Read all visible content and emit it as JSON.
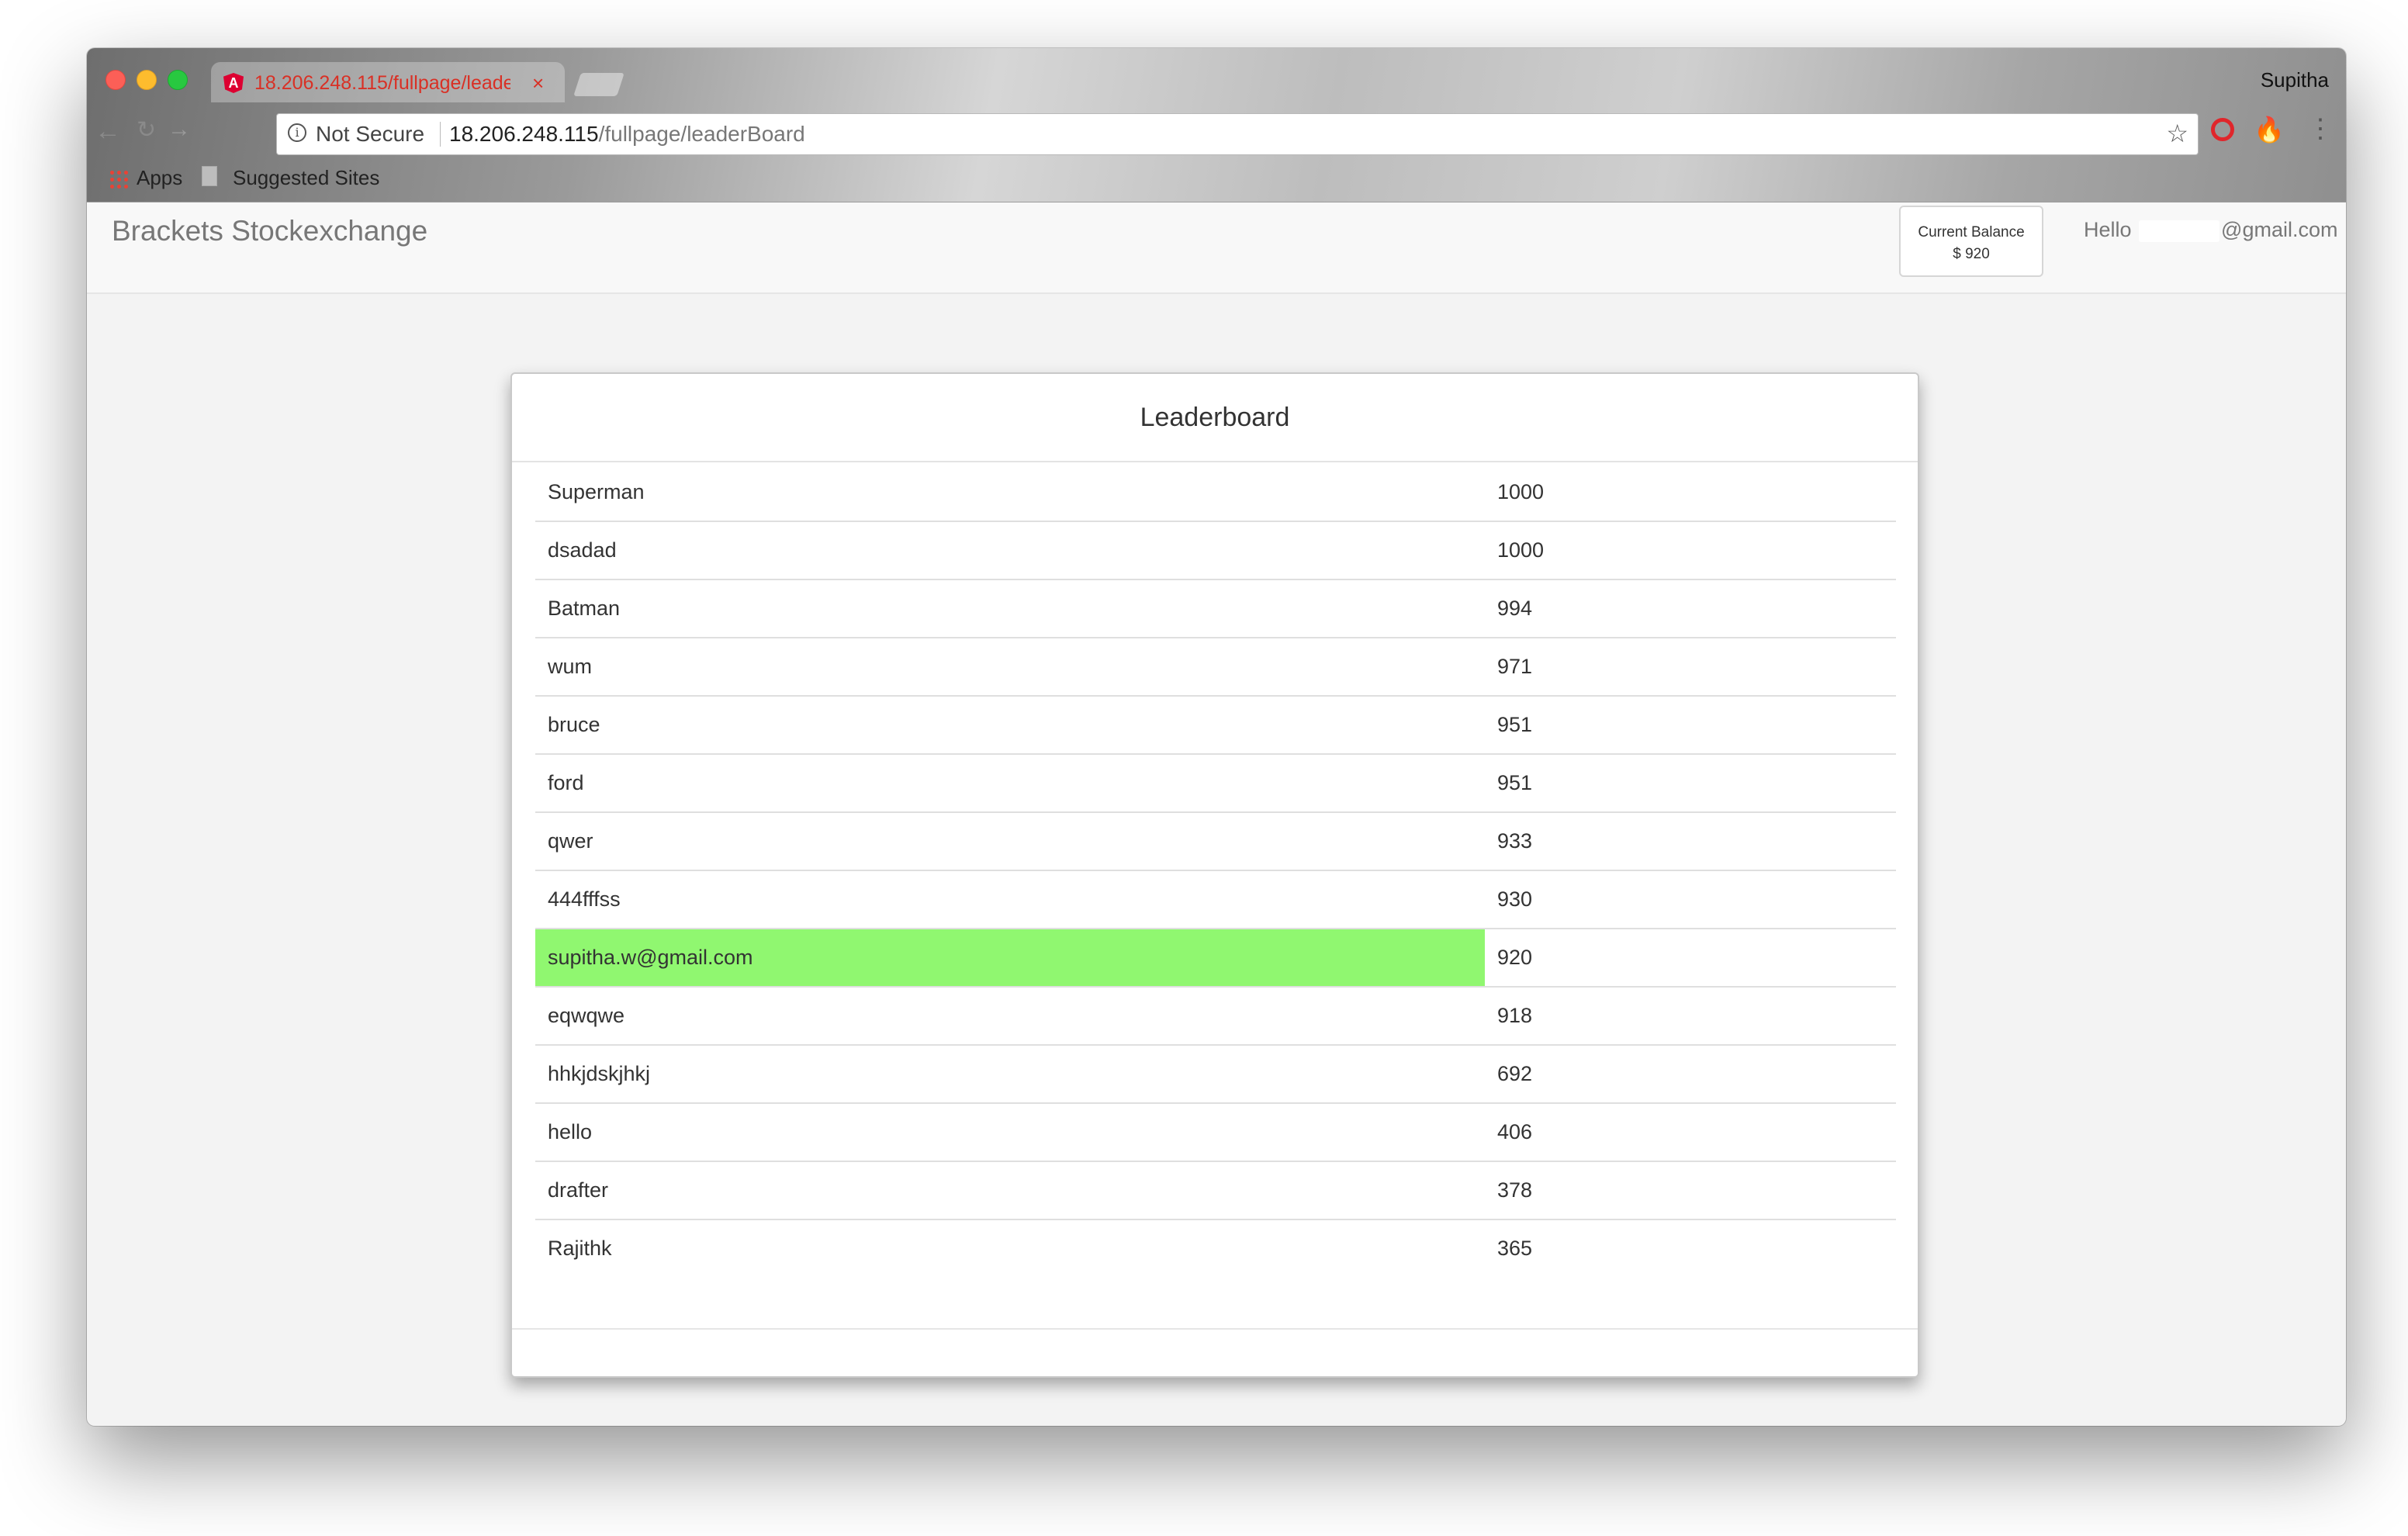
{
  "browser": {
    "tab_title": "18.206.248.115/fullpage/leade",
    "tab_close": "×",
    "profile_name": "Supitha",
    "security_label": "Not Secure",
    "url_host": "18.206.248.115",
    "url_path": "/fullpage/leaderBoard",
    "bookmarks": [
      "Apps",
      "Suggested Sites"
    ]
  },
  "navbar": {
    "brand": "Brackets Stockexchange",
    "balance_label": "Current Balance",
    "balance_value": "$ 920",
    "hello_prefix": "Hello",
    "hello_email_suffix": "@gmail.com"
  },
  "leaderboard": {
    "title": "Leaderboard",
    "rows": [
      {
        "name": "Superman",
        "score": "1000"
      },
      {
        "name": "dsadad",
        "score": "1000"
      },
      {
        "name": "Batman",
        "score": "994"
      },
      {
        "name": "wum",
        "score": "971"
      },
      {
        "name": "bruce",
        "score": "951"
      },
      {
        "name": "ford",
        "score": "951"
      },
      {
        "name": "qwer",
        "score": "933"
      },
      {
        "name": "444fffss",
        "score": "930"
      },
      {
        "name": "supitha.w@gmail.com",
        "score": "920"
      },
      {
        "name": "eqwqwe",
        "score": "918"
      },
      {
        "name": "hhkjdskjhkj",
        "score": "692"
      },
      {
        "name": "hello",
        "score": "406"
      },
      {
        "name": "drafter",
        "score": "378"
      },
      {
        "name": "Rajithk",
        "score": "365"
      }
    ],
    "highlight_color": "#90f770"
  }
}
